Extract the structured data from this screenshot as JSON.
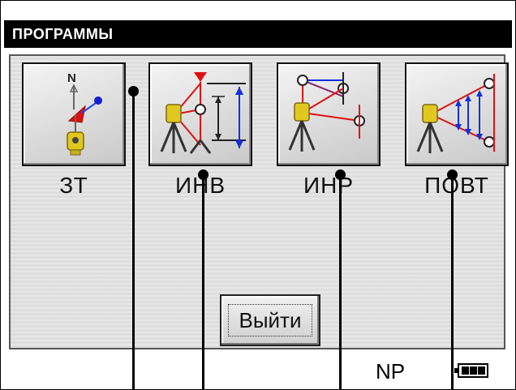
{
  "window": {
    "title": "ПРОГРАММЫ"
  },
  "programs": [
    {
      "label": "ЗТ",
      "icon": "station-orientation-icon"
    },
    {
      "label": "ИНВ",
      "icon": "remote-elevation-icon"
    },
    {
      "label": "ИНР",
      "icon": "missing-line-icon"
    },
    {
      "label": "ПОВТ",
      "icon": "repetition-measurement-icon"
    }
  ],
  "exit_button": {
    "label": "Выйти"
  },
  "status": {
    "mode": "NP",
    "battery": "battery-full-icon"
  },
  "colors": {
    "title_bg": "#000000",
    "accent_red": "#e01010",
    "accent_blue": "#1030e0",
    "instrument_yellow": "#d8c020"
  }
}
